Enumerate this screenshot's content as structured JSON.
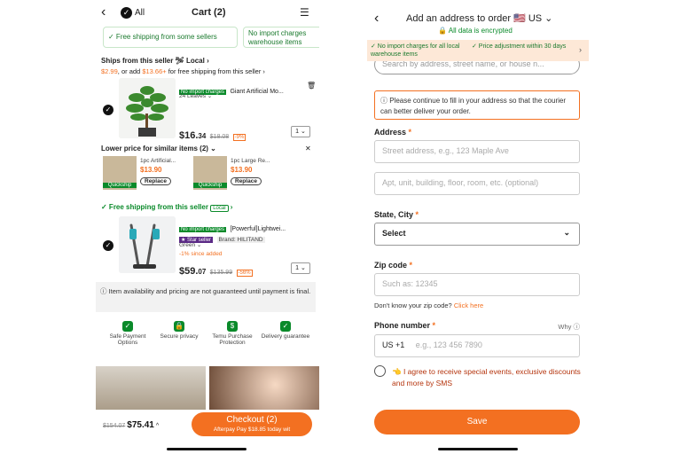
{
  "cart": {
    "back": "‹",
    "all_label": "All",
    "title": "Cart (2)",
    "menu": "☰",
    "chip_free": "✓ Free shipping from some sellers",
    "chip_noimport": "No import charges warehouse items",
    "seller1": "Ships from this seller 🛩 Local ›",
    "promo_amt1": "$2.99",
    "promo_mid": ", or add ",
    "promo_amt2": "$13.66+",
    "promo_end": " for free shipping from this seller ›",
    "item1": {
      "badge": "No import charges",
      "name": "Giant Artificial Mo...",
      "variant": "24 Leaves ⌄",
      "price_whole": "$16.",
      "price_cents": "34",
      "old_price": "$18.08",
      "discount": "-9%",
      "qty": "1 ⌄"
    },
    "similar_title": "Lower price for similar items (2) ⌄",
    "similar_close": "✕",
    "similar": [
      {
        "name": "1pc Artificial...",
        "price": "$13.90",
        "tag": "Quickship",
        "btn": "Replace"
      },
      {
        "name": "1pc Large Re...",
        "price": "$13.90",
        "tag": "Quickship",
        "btn": "Replace"
      }
    ],
    "seller2": "✓ Free shipping from this seller",
    "seller2_local": "Local",
    "item2": {
      "badge": "No import charges",
      "name": "[Powerful]Lightwei...",
      "star": "★ Star seller",
      "brand": "Brand: HILITAND",
      "variant": "Green ⌄",
      "since": "-1% since added",
      "price_whole": "$59.",
      "price_cents": "07",
      "old_price": "$135.99",
      "discount": "-56%",
      "qty": "1 ⌄"
    },
    "notice": "ⓘ Item availability and pricing are not guaranteed until payment is final.",
    "features": [
      {
        "icon": "✓",
        "label": "Safe Payment Options"
      },
      {
        "icon": "🔒",
        "label": "Secure privacy"
      },
      {
        "icon": "$",
        "label": "Temu Purchase Protection"
      },
      {
        "icon": "✓",
        "label": "Delivery guarantee"
      }
    ],
    "total_old": "$154.07",
    "total_new": "$75.41",
    "total_caret": "^",
    "checkout": "Checkout (2)",
    "checkout_sub": "Afterpay    Pay $18.85 today wit"
  },
  "address": {
    "back": "‹",
    "title": "Add an address to order 🇺🇸 US ⌄",
    "encrypted": "🔒 All data is encrypted",
    "banner1": "✓ No import charges for all local warehouse items",
    "banner2": "✓ Price adjustment within 30 days",
    "banner_arrow": "›",
    "search_placeholder": "Search by address, street name, or house n...",
    "warning": "ⓘ Please continue to fill in your address so that the courier can better deliver your order.",
    "address_label": "Address",
    "street_placeholder": "Street address, e.g., 123 Maple Ave",
    "apt_placeholder": "Apt, unit, building, floor, room, etc. (optional)",
    "state_label": "State, City",
    "select": "Select",
    "zip_label": "Zip code",
    "zip_placeholder": "Such as: 12345",
    "zip_hint": "Don't know your zip code? ",
    "zip_link": "Click here",
    "phone_label": "Phone number",
    "why": "Why ⓘ",
    "phone_prefix": "US +1",
    "phone_placeholder": "e.g., 123 456 7890",
    "agree": "👈 I agree to receive special events, exclusive discounts and more by SMS",
    "save": "Save",
    "required": "*"
  }
}
